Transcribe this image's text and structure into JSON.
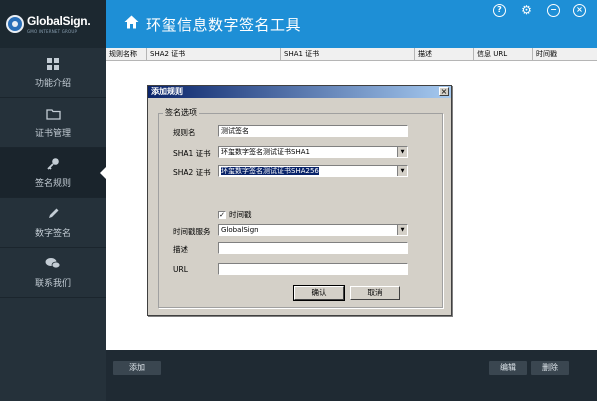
{
  "logo": {
    "name": "GlobalSign.",
    "tagline": "GMO INTERNET GROUP"
  },
  "sidebar": {
    "items": [
      {
        "label": "功能介绍",
        "icon": "grid-icon"
      },
      {
        "label": "证书管理",
        "icon": "folder-icon"
      },
      {
        "label": "签名规则",
        "icon": "key-icon",
        "active": true
      },
      {
        "label": "数字签名",
        "icon": "pen-icon"
      },
      {
        "label": "联系我们",
        "icon": "chat-icon"
      }
    ]
  },
  "header": {
    "title": "环玺信息数字签名工具",
    "controls": [
      "?",
      "⚙",
      "−",
      "×"
    ]
  },
  "table": {
    "columns": [
      "规则名称",
      "SHA2 证书",
      "SHA1 证书",
      "描述",
      "信息 URL",
      "时间戳"
    ]
  },
  "footer": {
    "add_label": "添加",
    "edit_label": "编辑",
    "delete_label": "删除"
  },
  "dialog": {
    "title": "添加规则",
    "close": "×",
    "group_label": "签名选项",
    "rule_name_label": "规则名",
    "rule_name_value": "测试签名",
    "sha1_label": "SHA1 证书",
    "sha1_value": "环玺数字签名测试证书SHA1",
    "sha2_label": "SHA2 证书",
    "sha2_value": "环玺数字签名测试证书SHA256",
    "timestamp_check": "✓",
    "timestamp_label": "时间戳",
    "ts_service_label": "时间戳服务",
    "ts_service_value": "GlobalSign",
    "desc_label": "描述",
    "desc_value": "",
    "url_label": "URL",
    "url_value": "",
    "ok_label": "确认",
    "cancel_label": "取消"
  },
  "colors": {
    "header": "#1e8fd6",
    "sidebar": "#25313a",
    "footer": "#1f2a33",
    "dialog_title": "#0a246a"
  }
}
